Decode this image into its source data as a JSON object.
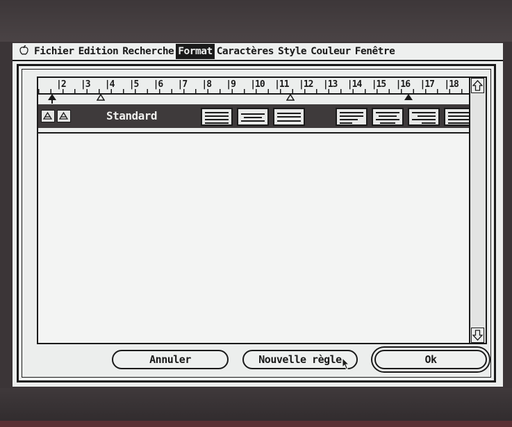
{
  "menubar": {
    "apple_label": "",
    "items": [
      "Fichier",
      "Edition",
      "Recherche",
      "Format",
      "Caractères",
      "Style",
      "Couleur",
      "Fenêtre"
    ],
    "active_index": 3
  },
  "ruler": {
    "numbers": [
      "2",
      "3",
      "4",
      "5",
      "6",
      "7",
      "8",
      "9",
      "10",
      "11",
      "12",
      "13",
      "14",
      "15",
      "16",
      "17",
      "18"
    ],
    "style_name": "Standard",
    "alignment_buttons": [
      "align-left",
      "align-center",
      "align-right",
      "justify",
      "align-left",
      "align-center",
      "align-right",
      "justify"
    ]
  },
  "buttons": {
    "cancel": "Annuler",
    "new_rule": "Nouvelle règle",
    "ok": "Ok"
  },
  "icons": {
    "apple": "apple-icon",
    "scroll_up": "arrow-up-icon",
    "scroll_down": "arrow-down-icon",
    "cursor": "mouse-pointer-icon"
  },
  "colors": {
    "screen": "#eceeed",
    "ink": "#1a1a1a",
    "bezel": "#3b3537"
  }
}
